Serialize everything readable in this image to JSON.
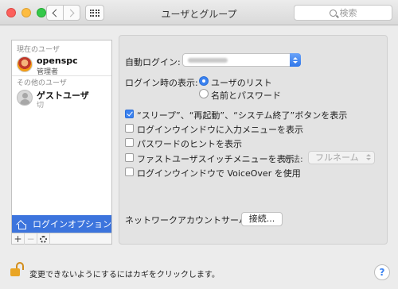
{
  "window": {
    "title": "ユーザとグループ",
    "search_placeholder": "検索"
  },
  "sidebar": {
    "current_user_header": "現在のユーザ",
    "other_users_header": "その他のユーザ",
    "users": [
      {
        "name": "openspc",
        "role": "管理者",
        "avatar": "photo"
      },
      {
        "name": "ゲストユーザ",
        "role": "切",
        "avatar": "guest-silhouette"
      }
    ],
    "login_options_label": "ログインオプション",
    "tools": {
      "add": "+",
      "remove": "−"
    }
  },
  "login_options": {
    "auto_login_label": "自動ログイン:",
    "auto_login_value": "",
    "display_label": "ログイン時の表示:",
    "display_options": [
      {
        "label": "ユーザのリスト",
        "selected": true
      },
      {
        "label": "名前とパスワード",
        "selected": false
      }
    ],
    "checkboxes": [
      {
        "label": "“スリープ”、“再起動”、“システム終了”ボタンを表示",
        "checked": true
      },
      {
        "label": "ログインウインドウに入力メニューを表示",
        "checked": false
      },
      {
        "label": "パスワードのヒントを表示",
        "checked": false
      },
      {
        "label": "ファストユーザスイッチメニューを表示",
        "checked": false
      },
      {
        "label": "ログインウインドウで VoiceOver を使用",
        "checked": false
      }
    ],
    "method_label": "方法:",
    "method_value": "フルネーム",
    "network_server_label": "ネットワークアカウントサーバ:",
    "join_button": "接続..."
  },
  "footer": {
    "lock_text": "変更できないようにするにはカギをクリックします。",
    "help": "?"
  },
  "colors": {
    "accent": "#3b82f0",
    "selection": "#3c74dd",
    "lock": "#e9a525"
  }
}
